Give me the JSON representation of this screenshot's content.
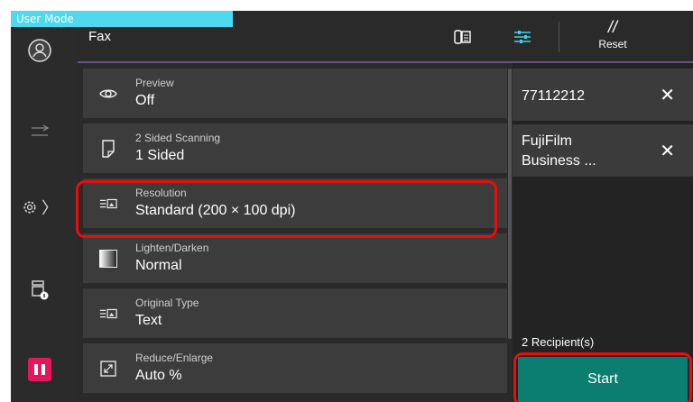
{
  "app": {
    "user_mode": "User Mode",
    "title": "Fax",
    "reset_label": "Reset"
  },
  "rail": {
    "icons": [
      "user-icon",
      "arrow-icon",
      "settings-icon",
      "chevron-right-icon",
      "printer-info-icon",
      "pause-icon"
    ],
    "colors": {
      "pause": "#e4165d"
    }
  },
  "settings": [
    {
      "label": "Preview",
      "value": "Off",
      "icon": "eye-icon"
    },
    {
      "label": "2 Sided Scanning",
      "value": "1 Sided",
      "icon": "page-icon"
    },
    {
      "label": "Resolution",
      "value": "Standard (200 × 100 dpi)",
      "icon": "resolution-icon"
    },
    {
      "label": "Lighten/Darken",
      "value": "Normal",
      "icon": "gradient-icon"
    },
    {
      "label": "Original Type",
      "value": "Text",
      "icon": "original-type-icon"
    },
    {
      "label": "Reduce/Enlarge",
      "value": "Auto %",
      "icon": "resize-icon"
    }
  ],
  "recipients": [
    {
      "line1": "77112212",
      "line2": ""
    },
    {
      "line1": "FujiFilm",
      "line2": "Business ..."
    }
  ],
  "recipient_count": "2 Recipient(s)",
  "start_label": "Start",
  "colors": {
    "accent": "#0b7d71",
    "highlight": "#ee0b0b",
    "user_mode_bar": "#4fd9ee",
    "header_line": "#6a4f86"
  }
}
